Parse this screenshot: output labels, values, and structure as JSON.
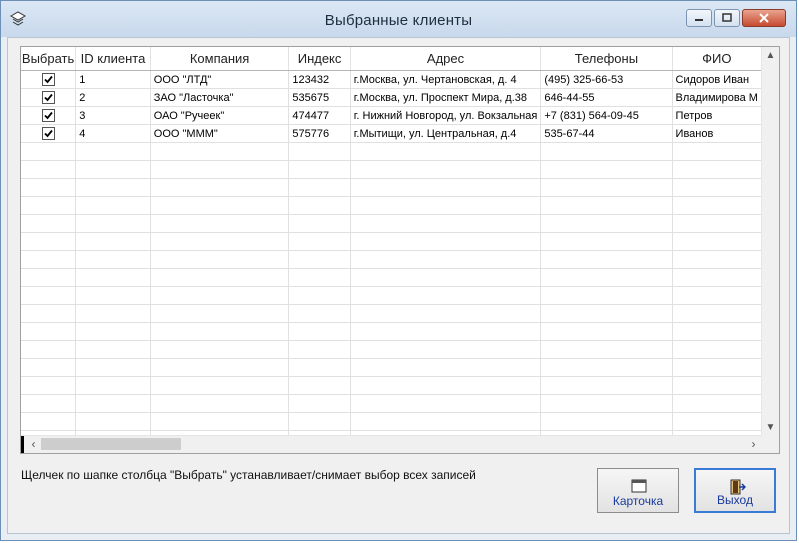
{
  "window": {
    "title": "Выбранные клиенты"
  },
  "grid": {
    "columns": [
      "Выбрать",
      "ID клиента",
      "Компания",
      "Индекс",
      "Адрес",
      "Телефоны",
      "ФИО"
    ],
    "rows": [
      {
        "checked": true,
        "id": "1",
        "company": "ООО \"ЛТД\"",
        "index": "123432",
        "address": "г.Москва, ул. Чертановская, д. 4",
        "phones": "(495) 325-66-53",
        "fio": "Сидоров Иван"
      },
      {
        "checked": true,
        "id": "2",
        "company": "ЗАО \"Ласточка\"",
        "index": "535675",
        "address": "г.Москва, ул. Проспект Мира, д.38",
        "phones": "646-44-55",
        "fio": "Владимирова М"
      },
      {
        "checked": true,
        "id": "3",
        "company": "ОАО \"Ручеек\"",
        "index": "474477",
        "address": "г. Нижний Новгород, ул. Вокзальная",
        "phones": "+7 (831) 564-09-45",
        "fio": "Петров"
      },
      {
        "checked": true,
        "id": "4",
        "company": "ООО \"МММ\"",
        "index": "575776",
        "address": "г.Мытищи, ул. Центральная, д.4",
        "phones": "535-67-44",
        "fio": "Иванов"
      }
    ],
    "empty_rows": 17
  },
  "hint": "Щелчек по шапке столбца \"Выбрать\" устанавливает/снимает выбор всех записей",
  "buttons": {
    "card_label": "Карточка",
    "exit_label": "Выход"
  },
  "colors": {
    "accent": "#1a3a9c",
    "title_bg": "#c8d9ec",
    "close_red": "#c64a30"
  }
}
